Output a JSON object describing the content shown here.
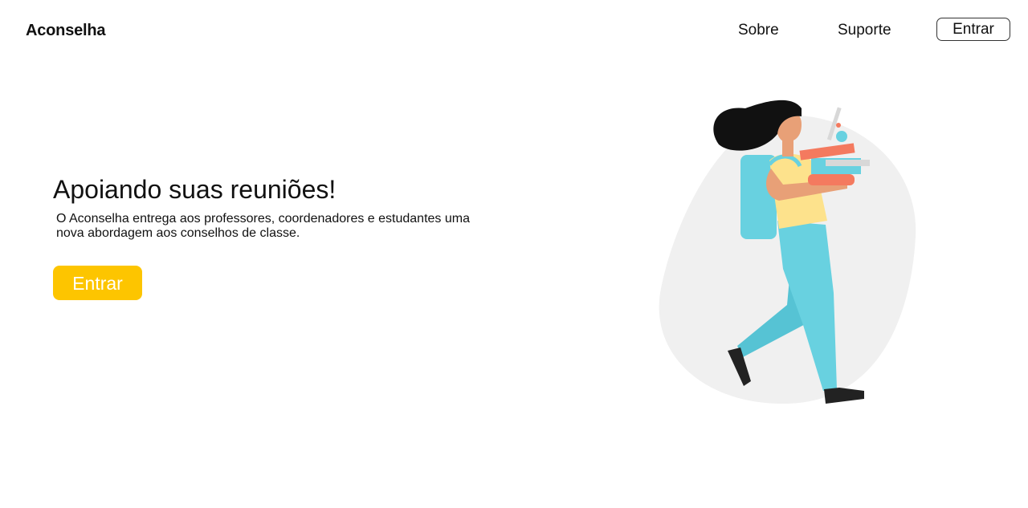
{
  "header": {
    "brand": "Aconselha",
    "nav": {
      "about": "Sobre",
      "support": "Suporte",
      "login": "Entrar"
    }
  },
  "hero": {
    "title": "Apoiando suas reuniões!",
    "description_line1": "O Aconselha entrega aos professores, coordenadores e estudantes uma",
    "description_line2": "nova abordagem aos conselhos de classe.",
    "cta": "Entrar"
  },
  "colors": {
    "accent": "#fdc500",
    "blob": "#f0f0f0",
    "teal": "#68d1e0",
    "shirt": "#fde28c",
    "skin": "#e8a077",
    "coral": "#f47a5f"
  },
  "icons": {
    "illustration": "student-carrying-books-illustration"
  }
}
